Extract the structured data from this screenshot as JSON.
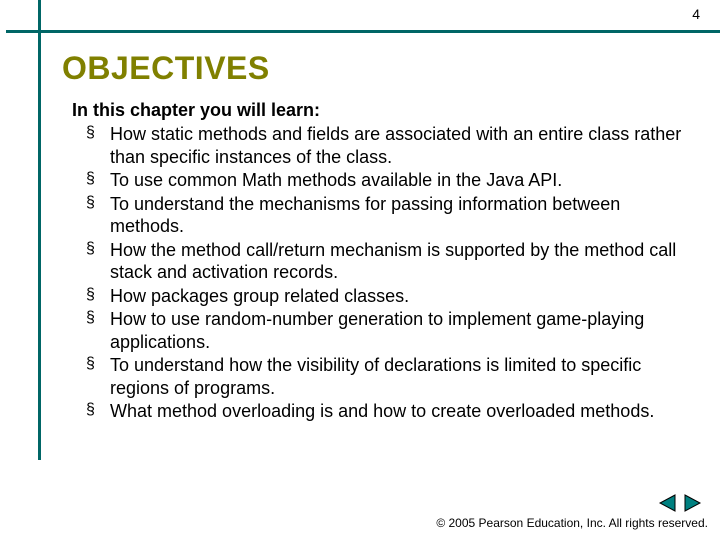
{
  "page_number": "4",
  "heading": "OBJECTIVES",
  "intro": "In this chapter you will learn:",
  "bullets": [
    "How static methods and fields are associated with an entire class rather than specific instances of the class.",
    "To use common Math methods available in the Java API.",
    "To understand the mechanisms for passing information between methods.",
    "How the method call/return mechanism is supported by the method call stack and activation records.",
    "How packages group related classes.",
    "How to use random-number generation to implement game-playing applications.",
    "To understand how the visibility of declarations is limited to specific regions of programs.",
    "What method overloading is and how to create overloaded methods."
  ],
  "copyright": "© 2005 Pearson Education, Inc.  All rights reserved.",
  "colors": {
    "rule": "#006666",
    "heading": "#808000",
    "nav_fill": "#008080",
    "nav_outline": "#000000"
  }
}
